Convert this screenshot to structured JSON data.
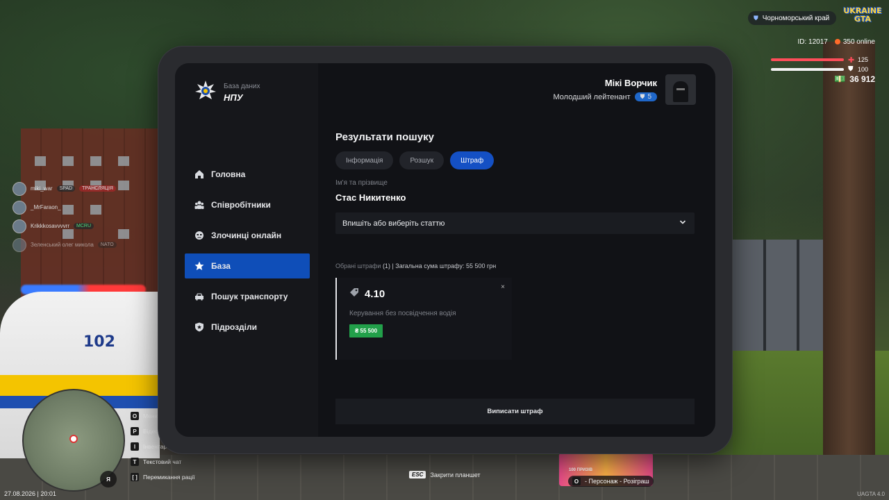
{
  "hud": {
    "region": "Чорноморський край",
    "logo_line1": "UKRAINE",
    "logo_line2": "GTA",
    "id_text": "ID: 12017",
    "online_text": "350 online",
    "health": "125",
    "armor": "100",
    "money": "36 912",
    "date_time": "27.08.2026 | 20:01",
    "mic_key": "Я",
    "esc_key": "ESC",
    "esc_label": "Закрити планшет",
    "banner_key": "O",
    "banner_label": "- Персонаж - Розіграш",
    "banner_text": "100 ПРИЗІВ",
    "version": "UAGTA 4.0"
  },
  "scene": {
    "car_plate": "102"
  },
  "chat": [
    {
      "name": "miki_war",
      "tag1": "SPAD",
      "tag2": "ТРАНСЛЯЦІЯ"
    },
    {
      "name": "_MrFaraon_",
      "tag1": "",
      "tag2": ""
    },
    {
      "name": "Krikkkosavvvvrr",
      "tag1": "MCRU",
      "tag2": ""
    },
    {
      "name": "Зеленський олег микола",
      "tag1": "NATO",
      "tag2": ""
    }
  ],
  "keys": [
    {
      "key": "O",
      "label": "Меню"
    },
    {
      "key": "P",
      "label": "Відео"
    },
    {
      "key": "I",
      "label": "Інвентар"
    },
    {
      "key": "T",
      "label": "Текстовий чат"
    },
    {
      "key": "[ ]",
      "label": "Перемикання рації"
    }
  ],
  "tablet": {
    "brand_sub": "База даних",
    "brand_title": "НПУ",
    "menu": [
      {
        "label": "Головна",
        "icon": "home-icon"
      },
      {
        "label": "Співробітники",
        "icon": "users-icon"
      },
      {
        "label": "Злочинці онлайн",
        "icon": "criminal-icon"
      },
      {
        "label": "База",
        "icon": "star-icon",
        "active": true
      },
      {
        "label": "Пошук транспорту",
        "icon": "car-icon"
      },
      {
        "label": "Підрозділи",
        "icon": "shield-icon"
      }
    ],
    "profile": {
      "name": "Мікі Ворчик",
      "rank": "Молодший лейтенант",
      "rank_level": "5"
    },
    "content": {
      "title": "Результати пошуку",
      "tabs": [
        {
          "label": "Інформація"
        },
        {
          "label": "Розшук"
        },
        {
          "label": "Штраф",
          "active": true
        }
      ],
      "name_label": "Ім'я та прізвище",
      "name_value": "Стас Никитенко",
      "select_placeholder": "Впишіть або виберіть статтю",
      "summary_muted": "Обрані штрафи",
      "summary_text": "(1) | Загальна сума штрафу: 55 500 грн",
      "fine": {
        "code": "4.10",
        "description": "Керування без посвідчення водія",
        "amount": "₴ 55 500",
        "close": "×"
      },
      "issue_button": "Виписати штраф"
    }
  },
  "colors": {
    "accent": "#1450c4",
    "menu_active": "#0f4eb8",
    "fine_green": "#22a04a",
    "health_red": "#ff4d5a"
  }
}
